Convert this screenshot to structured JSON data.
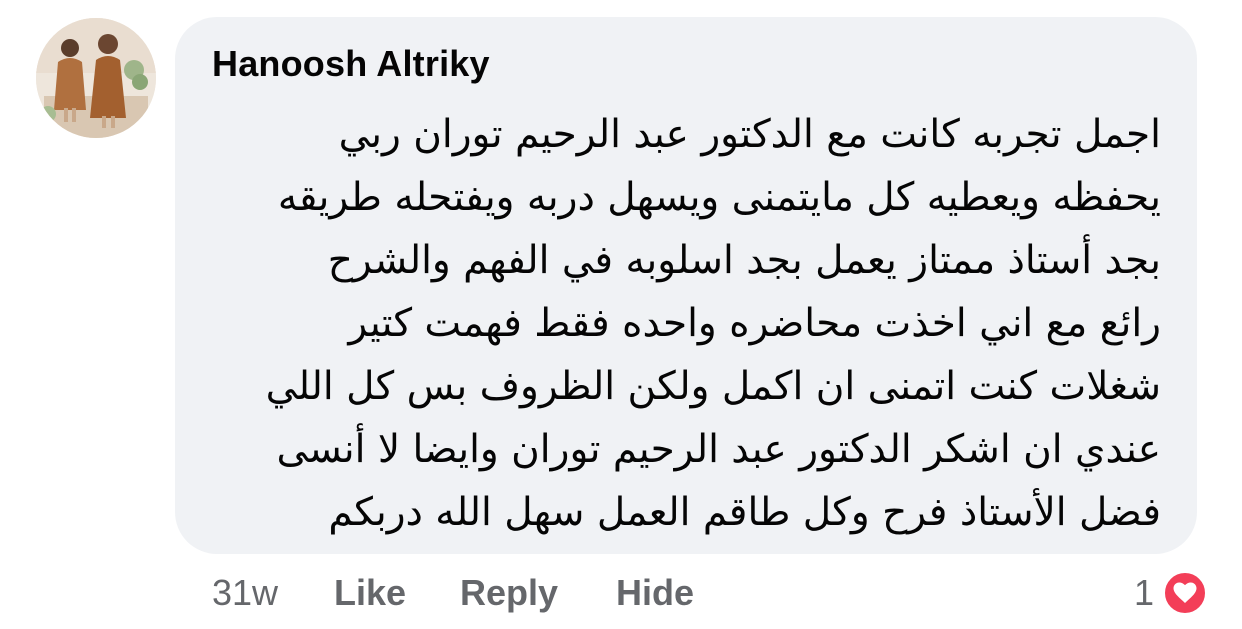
{
  "comment": {
    "author": "Hanoosh Altriky",
    "lines": [
      "اجمل تجربه كانت مع الدكتور عبد الرحيم توران ربي",
      "يحفظه ويعطيه كل مايتمنى ويسهل دربه ويفتحله طريقه",
      "بجد أستاذ ممتاز يعمل بجد اسلوبه في الفهم والشرح",
      "رائع مع اني اخذت محاضره واحده فقط فهمت كتير",
      "شغلات كنت اتمنى ان اكمل ولكن الظروف بس كل اللي",
      "عندي ان اشكر الدكتور عبد الرحيم توران وايضا لا أنسى",
      "فضل الأستاذ فرح  وكل طاقم العمل سهل الله دربكم"
    ],
    "bubble_color": "#f0f2f5"
  },
  "actions": {
    "timestamp": "31w",
    "like_label": "Like",
    "reply_label": "Reply",
    "hide_label": "Hide"
  },
  "reactions": {
    "count": "1",
    "icon": "heart-icon",
    "color": "#f33e58"
  }
}
